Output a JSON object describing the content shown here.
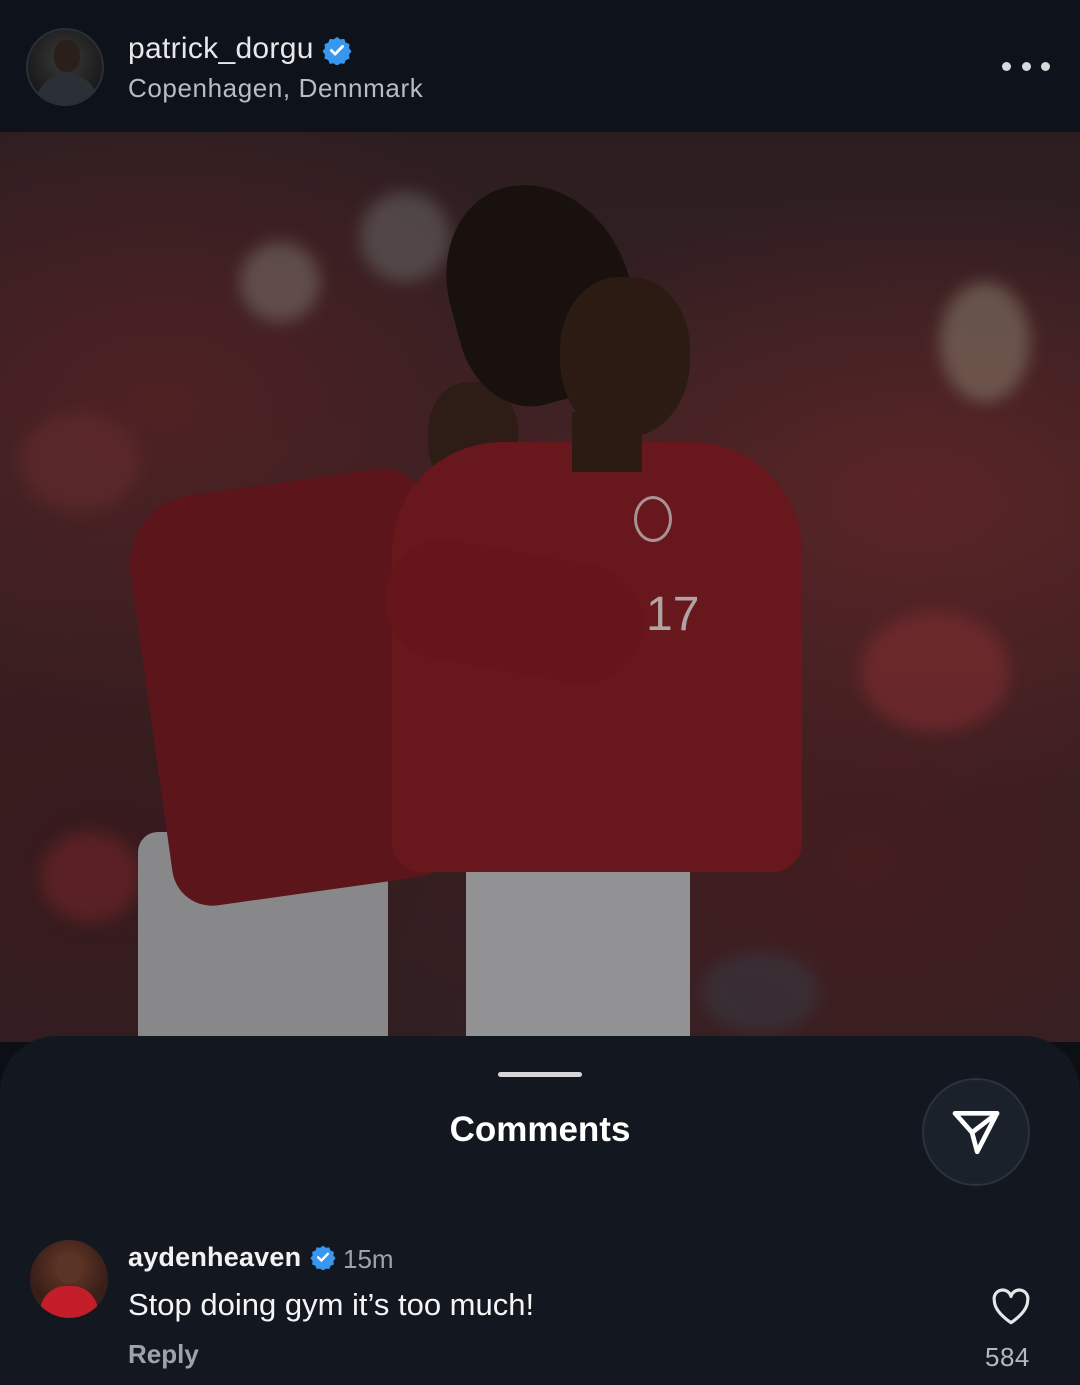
{
  "post": {
    "username": "patrick_dorgu",
    "location": "Copenhagen, Dennmark",
    "jersey_number": "17"
  },
  "comments_sheet": {
    "title": "Comments"
  },
  "comment": {
    "username": "aydenheaven",
    "time": "15m",
    "text": "Stop doing gym it’s too much!",
    "reply_label": "Reply",
    "like_count": "584"
  },
  "colors": {
    "verified": "#3897f0",
    "sheet_bg": "#131820",
    "topbar_bg": "#0e121a"
  }
}
